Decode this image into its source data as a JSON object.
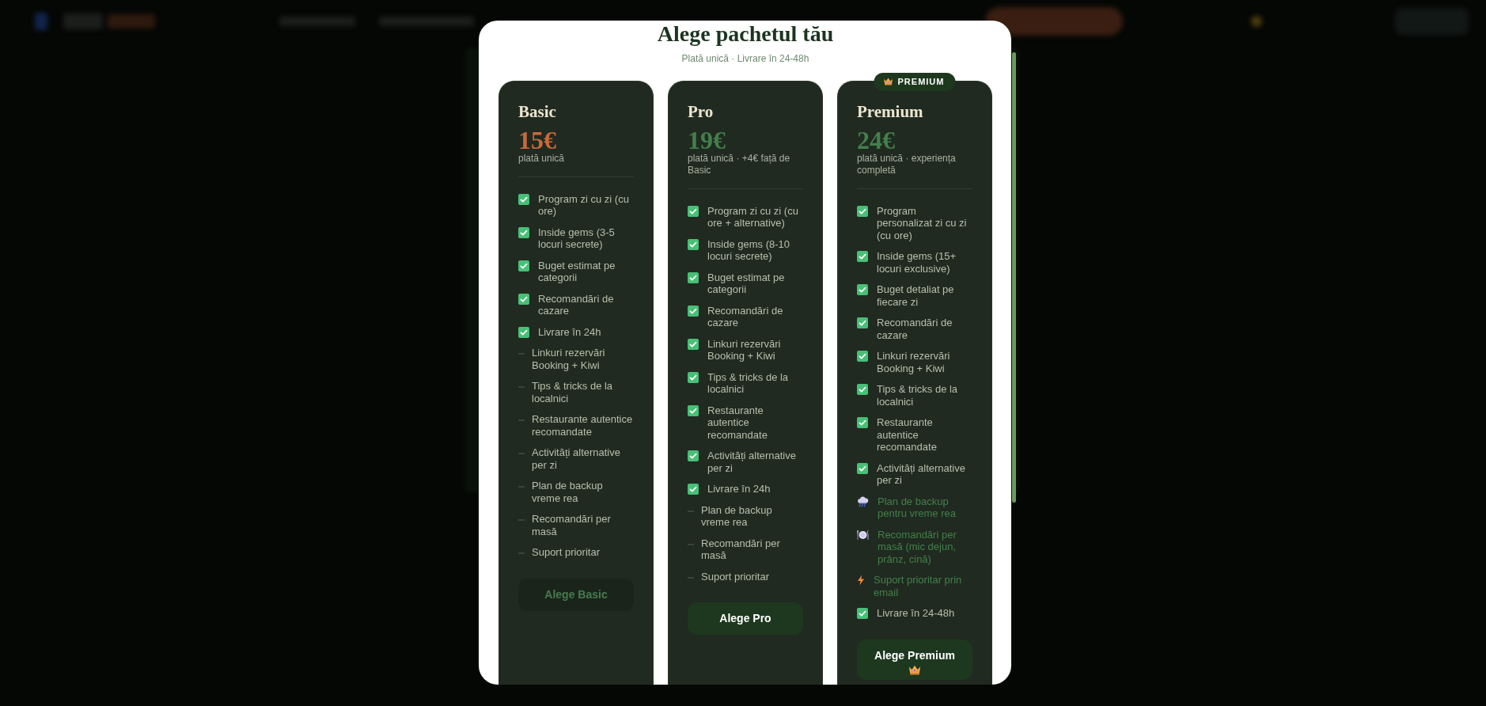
{
  "modal": {
    "title": "Alege pachetul tău",
    "subtitle": "Plată unică · Livrare în 24-48h"
  },
  "plans": [
    {
      "name": "Basic",
      "kind": "standard",
      "price": "15€",
      "color": "#c86a3b",
      "price_note": "plată unică",
      "features": [
        {
          "text": "Program zi cu zi (cu ore)",
          "kind": "included"
        },
        {
          "text": "Inside gems (3-5 locuri secrete)",
          "kind": "included"
        },
        {
          "text": "Buget estimat pe categorii",
          "kind": "included"
        },
        {
          "text": "Recomandări de cazare",
          "kind": "included"
        },
        {
          "text": "Livrare în 24h",
          "kind": "included"
        },
        {
          "text": "Linkuri rezervări Booking + Kiwi",
          "kind": "excluded"
        },
        {
          "text": "Tips & tricks de la localnici",
          "kind": "excluded"
        },
        {
          "text": "Restaurante autentice recomandate",
          "kind": "excluded"
        },
        {
          "text": "Activități alternative per zi",
          "kind": "excluded"
        },
        {
          "text": "Plan de backup vreme rea",
          "kind": "excluded"
        },
        {
          "text": "Recomandări per masă",
          "kind": "excluded"
        },
        {
          "text": "Suport prioritar",
          "kind": "excluded"
        }
      ],
      "button": {
        "label": "Alege Basic",
        "disabled": true
      }
    },
    {
      "name": "Pro",
      "kind": "standard",
      "price": "19€",
      "color": "#437f4b",
      "price_note": "plată unică · +4€ față de Basic",
      "features": [
        {
          "text": "Program zi cu zi (cu ore + alternative)",
          "kind": "included"
        },
        {
          "text": "Inside gems (8-10 locuri secrete)",
          "kind": "included"
        },
        {
          "text": "Buget estimat pe categorii",
          "kind": "included"
        },
        {
          "text": "Recomandări de cazare",
          "kind": "included"
        },
        {
          "text": "Linkuri rezervări Booking + Kiwi",
          "kind": "included"
        },
        {
          "text": "Tips & tricks de la localnici",
          "kind": "included"
        },
        {
          "text": "Restaurante autentice recomandate",
          "kind": "included"
        },
        {
          "text": "Activități alternative per zi",
          "kind": "included"
        },
        {
          "text": "Livrare în 24h",
          "kind": "included"
        },
        {
          "text": "Plan de backup vreme rea",
          "kind": "excluded"
        },
        {
          "text": "Recomandări per masă",
          "kind": "excluded"
        },
        {
          "text": "Suport prioritar",
          "kind": "excluded"
        }
      ],
      "button": {
        "label": "Alege Pro",
        "disabled": false
      }
    },
    {
      "name": "Premium",
      "kind": "premium",
      "badge": "PREMIUM",
      "price": "24€",
      "color": "#437f4b",
      "price_note": "plată unică · experiența completă",
      "features": [
        {
          "text": "Program personalizat zi cu zi (cu ore)",
          "kind": "included"
        },
        {
          "text": "Inside gems (15+ locuri exclusive)",
          "kind": "included"
        },
        {
          "text": "Buget detaliat pe fiecare zi",
          "kind": "included"
        },
        {
          "text": "Recomandări de cazare",
          "kind": "included"
        },
        {
          "text": "Linkuri rezervări Booking + Kiwi",
          "kind": "included"
        },
        {
          "text": "Tips & tricks de la localnici",
          "kind": "included"
        },
        {
          "text": "Restaurante autentice recomandate",
          "kind": "included"
        },
        {
          "text": "Activități alternative per zi",
          "kind": "included"
        },
        {
          "text": "Plan de backup pentru vreme rea",
          "kind": "bonus"
        },
        {
          "text": "Recomandări per masă (mic dejun, prânz, cină)",
          "kind": "bonus"
        },
        {
          "text": "Suport prioritar prin email",
          "kind": "bonus"
        },
        {
          "text": "Livrare în 24-48h",
          "kind": "included"
        }
      ],
      "button": {
        "label": "Alege Premium",
        "disabled": false
      }
    }
  ]
}
